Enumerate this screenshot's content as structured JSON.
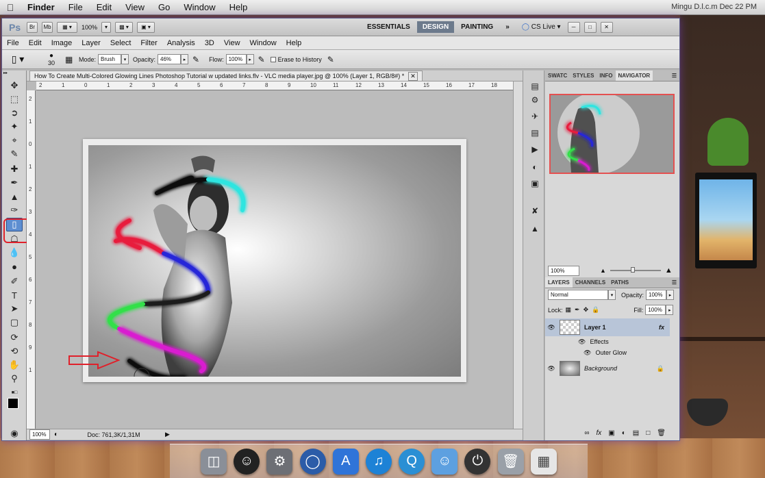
{
  "mac_menubar": {
    "items": [
      "Finder",
      "File",
      "Edit",
      "View",
      "Go",
      "Window",
      "Help"
    ],
    "right_text": "Mingu D.l.c.m Dec 22 PM"
  },
  "app_bar": {
    "logo": "Ps",
    "bridge": "Br",
    "minibridge": "Mb",
    "zoom": "100%",
    "workspaces": [
      "ESSENTIALS",
      "DESIGN",
      "PAINTING"
    ],
    "active_workspace": "DESIGN",
    "more": "»",
    "cslive": "CS Live"
  },
  "menu": [
    "File",
    "Edit",
    "Image",
    "Layer",
    "Select",
    "Filter",
    "Analysis",
    "3D",
    "View",
    "Window",
    "Help"
  ],
  "options": {
    "brush_size": "30",
    "mode_label": "Mode:",
    "mode_value": "Brush",
    "opacity_label": "Opacity:",
    "opacity_value": "46%",
    "flow_label": "Flow:",
    "flow_value": "100%",
    "erase_history": "Erase to History"
  },
  "document": {
    "tab_title": "How To Create Multi-Colored Glowing Lines Photoshop Tutorial w updated links.flv - VLC media player.jpg @ 100% (Layer 1, RGB/8#) *",
    "zoom": "100%",
    "doc_info": "Doc: 761,3K/1,31M"
  },
  "ruler_h": [
    "2",
    "1",
    "0",
    "1",
    "2",
    "3",
    "4",
    "5",
    "6",
    "7",
    "8",
    "9",
    "10",
    "11",
    "12",
    "13",
    "14",
    "15",
    "16",
    "17",
    "18"
  ],
  "ruler_v": [
    "2",
    "1",
    "0",
    "1",
    "2",
    "3",
    "4",
    "5",
    "6",
    "7",
    "8",
    "9",
    "1"
  ],
  "panels": {
    "top_tabs": [
      "SWATC",
      "STYLES",
      "INFO",
      "NAVIGATOR"
    ],
    "active_top_tab": "NAVIGATOR",
    "nav_zoom": "100%",
    "layer_tabs": [
      "LAYERS",
      "CHANNELS",
      "PATHS"
    ],
    "blend_mode": "Normal",
    "opacity_label": "Opacity:",
    "opacity_value": "100%",
    "lock_label": "Lock:",
    "fill_label": "Fill:",
    "fill_value": "100%",
    "layers": {
      "layer1": "Layer 1",
      "fx": "fx",
      "effects": "Effects",
      "outer_glow": "Outer Glow",
      "background": "Background"
    }
  },
  "colors": {
    "accent": "#6c7a8c",
    "highlight_red": "#e0202a",
    "selected_tool": "#5d8ed1"
  },
  "icons": {
    "tools": [
      "move-icon",
      "marquee-icon",
      "lasso-icon",
      "quick-select-icon",
      "crop-icon",
      "eyedropper-icon",
      "healing-icon",
      "brush-icon",
      "clone-stamp-icon",
      "history-brush-icon",
      "eraser-icon",
      "paint-bucket-icon",
      "blur-icon",
      "dodge-icon",
      "pen-icon",
      "type-icon",
      "path-select-icon",
      "shape-icon",
      "3d-rotate-icon",
      "3d-orbit-icon",
      "hand-icon",
      "zoom-icon"
    ]
  }
}
